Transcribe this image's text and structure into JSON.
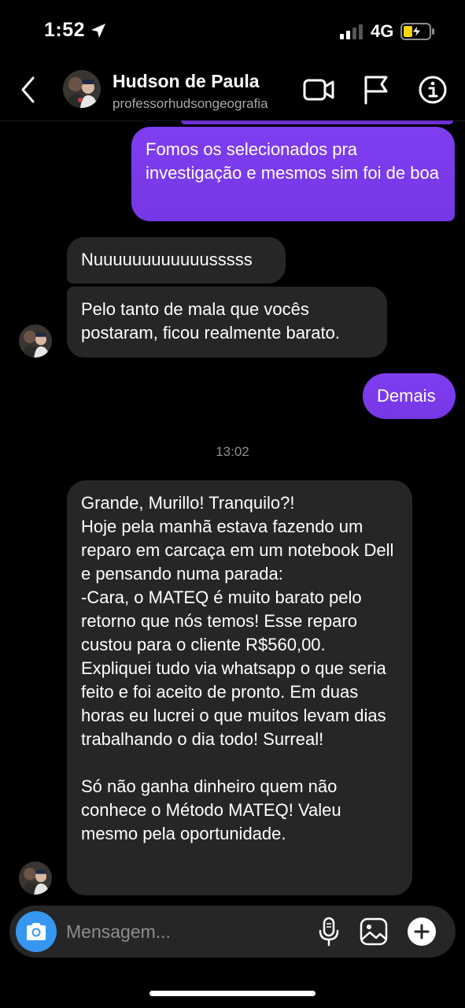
{
  "status_bar": {
    "time": "1:52",
    "network": "4G",
    "icons": [
      "location-arrow-icon",
      "signal-bars-icon",
      "battery-charging-icon"
    ]
  },
  "header": {
    "name": "Hudson de Paula",
    "username": "professorhudsongeografia",
    "icons": [
      "back-chevron-icon",
      "video-call-icon",
      "flag-icon",
      "info-icon"
    ]
  },
  "messages": [
    {
      "from": "me",
      "text": "Fomos os selecionados pra investigação e mesmos sim foi de boa"
    },
    {
      "from": "them",
      "text": "Nuuuuuuuuuuuusssss"
    },
    {
      "from": "them",
      "text": "Pelo tanto de mala que vocês postaram, ficou realmente barato."
    },
    {
      "from": "me",
      "text": "Demais"
    },
    {
      "from": "them",
      "text": "Grande, Murillo! Tranquilo?!\nHoje pela manhã estava fazendo um reparo em carcaça em um notebook Dell e pensando numa parada:\n-Cara, o MATEQ é muito barato pelo retorno que nós temos! Esse reparo custou para o cliente R$560,00. Expliquei tudo via whatsapp o que seria feito e foi aceito de pronto. Em duas horas eu lucrei o que muitos levam dias trabalhando o dia todo! Surreal!\n\nSó não ganha dinheiro quem não conhece o Método MATEQ! Valeu mesmo pela oportunidade."
    }
  ],
  "timestamp": "13:02",
  "composer": {
    "placeholder": "Mensagem...",
    "icons": [
      "camera-icon",
      "microphone-icon",
      "gallery-icon",
      "plus-icon"
    ]
  },
  "colors": {
    "sent_bubble": "#7c3aed",
    "received_bubble": "#262626",
    "camera_button": "#3797f0",
    "background": "#000000"
  }
}
